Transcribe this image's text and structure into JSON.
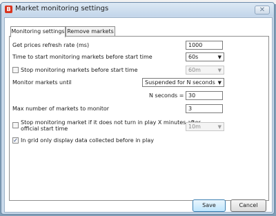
{
  "window": {
    "title": "Market monitoring settings",
    "close_symbol": "✕"
  },
  "tabs": [
    {
      "label": "Monitoring settings",
      "active": true
    },
    {
      "label": "Remove markets",
      "active": false
    }
  ],
  "settings": {
    "refresh_rate": {
      "label": "Get prices refresh rate (ms)",
      "value": "1000"
    },
    "start_monitoring": {
      "label": "Time to start monitoring markets before start time",
      "value": "60s"
    },
    "stop_before_start": {
      "label": "Stop monitoring markets before start time",
      "checked": false,
      "value": "60m"
    },
    "monitor_until": {
      "label": "Monitor markets until",
      "value": "Suspended for N seconds"
    },
    "n_seconds": {
      "label": "N seconds =",
      "value": "30"
    },
    "max_markets": {
      "label": "Max number of markets to monitor",
      "value": "3"
    },
    "stop_not_inplay": {
      "label_line1": "Stop monitoring market if it does not turn in play X minutes after",
      "label_line2": "official start time",
      "checked": false,
      "value": "10m"
    },
    "grid_inplay_only": {
      "label": "In grid only display data collected before in play",
      "checked": true
    }
  },
  "buttons": {
    "save": "Save",
    "cancel": "Cancel"
  },
  "icons": {
    "caret": "▼",
    "check": "✓"
  },
  "colors": {
    "frame": "#c9d9ea",
    "app_icon": "#d9341f",
    "save_button": "#bee6fd"
  }
}
